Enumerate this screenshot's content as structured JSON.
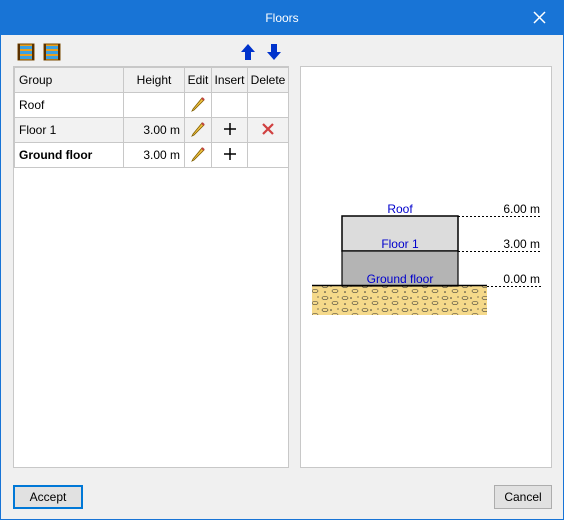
{
  "window": {
    "title": "Floors"
  },
  "toolbar": {
    "icons": [
      "floor-group-icon",
      "floor-group-alt-icon",
      "move-up-arrow-icon",
      "move-down-arrow-icon"
    ],
    "accent": "#0033cc"
  },
  "table": {
    "headers": [
      "Group",
      "Height",
      "Edit",
      "Insert",
      "Delete"
    ],
    "rows": [
      {
        "group": "Roof",
        "height": "",
        "edit": true,
        "insert": false,
        "delete": false
      },
      {
        "group": "Floor 1",
        "height": "3.00 m",
        "edit": true,
        "insert": true,
        "delete": true
      },
      {
        "group": "Ground floor",
        "height": "3.00 m",
        "edit": true,
        "insert": true,
        "delete": false
      }
    ]
  },
  "drawing": {
    "levels": [
      {
        "name": "Roof",
        "elevation": "6.00 m"
      },
      {
        "name": "Floor 1",
        "elevation": "3.00 m"
      },
      {
        "name": "Ground floor",
        "elevation": "0.00 m"
      }
    ],
    "colors": {
      "label": "#0000cc",
      "upper_floor": "#dcdcdc",
      "lower_floor": "#b4b4b4",
      "ground": "#f5d98a"
    }
  },
  "footer": {
    "accept_label": "Accept",
    "cancel_label": "Cancel"
  }
}
